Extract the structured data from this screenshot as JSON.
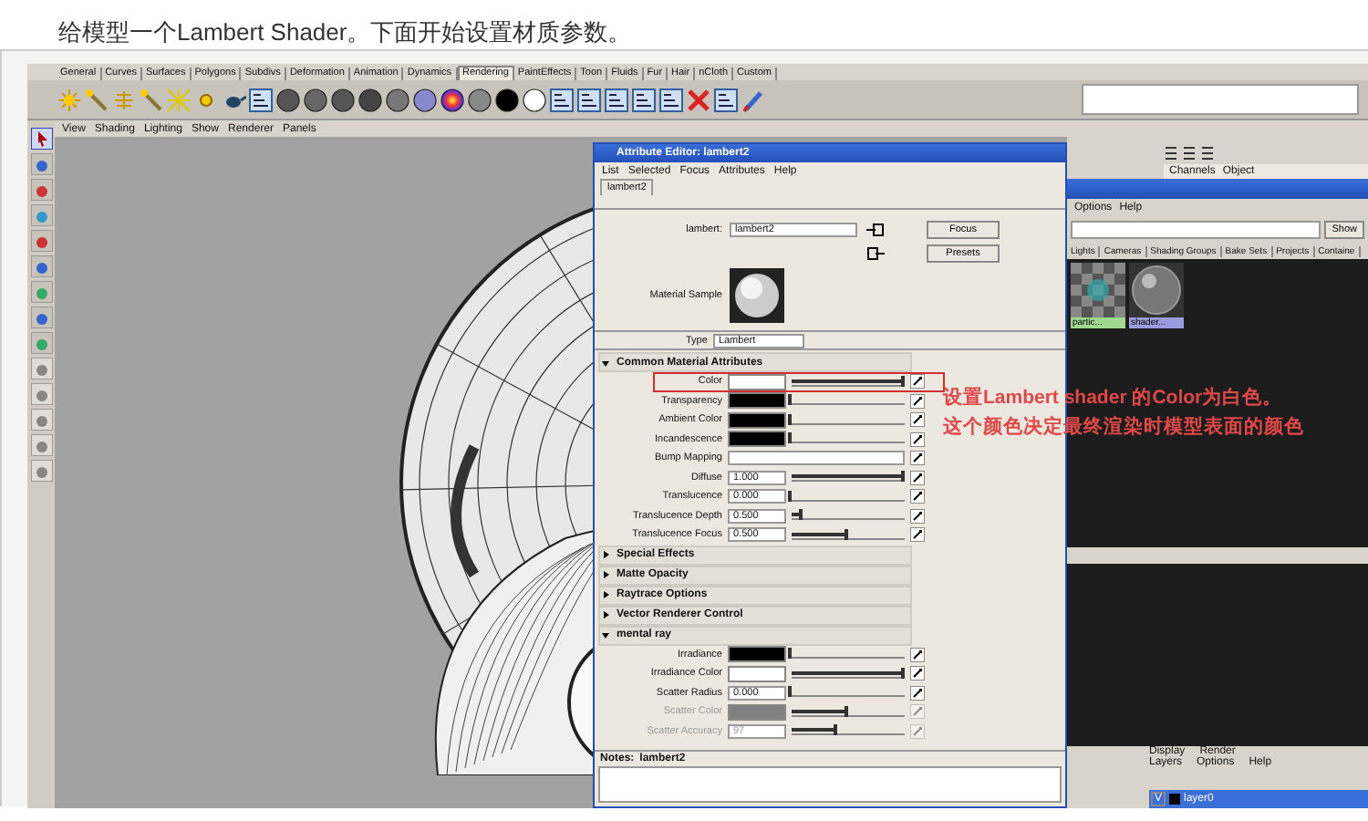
{
  "caption": "给模型一个Lambert Shader。下面开始设置材质参数。",
  "shelf_tabs": [
    {
      "label": "General",
      "selected": false
    },
    {
      "label": "Curves",
      "selected": false
    },
    {
      "label": "Surfaces",
      "selected": false
    },
    {
      "label": "Polygons",
      "selected": false
    },
    {
      "label": "Subdivs",
      "selected": false
    },
    {
      "label": "Deformation",
      "selected": false
    },
    {
      "label": "Animation",
      "selected": false
    },
    {
      "label": "Dynamics",
      "selected": false
    },
    {
      "label": "Rendering",
      "selected": true
    },
    {
      "label": "PaintEffects",
      "selected": false
    },
    {
      "label": "Toon",
      "selected": false
    },
    {
      "label": "Fluids",
      "selected": false
    },
    {
      "label": "Fur",
      "selected": false
    },
    {
      "label": "Hair",
      "selected": false
    },
    {
      "label": "nCloth",
      "selected": false
    },
    {
      "label": "Custom",
      "selected": false
    }
  ],
  "viewport_menu": [
    "View",
    "Shading",
    "Lighting",
    "Show",
    "Renderer",
    "Panels"
  ],
  "attribute_editor": {
    "title": "Attribute Editor: lambert2",
    "menu": [
      "List",
      "Selected",
      "Focus",
      "Attributes",
      "Help"
    ],
    "tab": "lambert2",
    "node_label": "lambert:",
    "node_name": "lambert2",
    "buttons": [
      "Focus",
      "Presets"
    ],
    "sample_label": "Material Sample",
    "type_label": "Type",
    "type_value": "Lambert",
    "sections": [
      {
        "title": "Common Material Attributes",
        "expanded": true,
        "attributes": [
          {
            "kind": "color",
            "label": "Color",
            "color": "#ffffff",
            "level": 1,
            "highlighted": true,
            "disabled": false
          },
          {
            "kind": "color",
            "label": "Transparency",
            "color": "#000000",
            "level": 0,
            "highlighted": false,
            "disabled": false
          },
          {
            "kind": "color",
            "label": "Ambient Color",
            "color": "#000000",
            "level": 0,
            "highlighted": false,
            "disabled": false
          },
          {
            "kind": "color",
            "label": "Incandescence",
            "color": "#000000",
            "level": 0,
            "highlighted": false,
            "disabled": false
          },
          {
            "kind": "map",
            "label": "Bump Mapping",
            "highlighted": false,
            "disabled": false
          },
          {
            "kind": "number",
            "label": "Diffuse",
            "value": "1.000",
            "level": 1,
            "highlighted": false,
            "disabled": false
          },
          {
            "kind": "number",
            "label": "Translucence",
            "value": "0.000",
            "level": 0,
            "highlighted": false,
            "disabled": false
          },
          {
            "kind": "number",
            "label": "Translucence Depth",
            "value": "0.500",
            "level": 0.1,
            "highlighted": false,
            "disabled": false
          },
          {
            "kind": "number",
            "label": "Translucence Focus",
            "value": "0.500",
            "level": 0.5,
            "highlighted": false,
            "disabled": false
          }
        ]
      },
      {
        "title": "Special Effects",
        "expanded": false
      },
      {
        "title": "Matte Opacity",
        "expanded": false
      },
      {
        "title": "Raytrace Options",
        "expanded": false
      },
      {
        "title": "Vector Renderer Control",
        "expanded": false
      },
      {
        "title": "mental ray",
        "expanded": true,
        "attributes": [
          {
            "kind": "color",
            "label": "Irradiance",
            "color": "#000000",
            "level": 0,
            "highlighted": false,
            "disabled": false
          },
          {
            "kind": "color",
            "label": "Irradiance Color",
            "color": "#ffffff",
            "level": 1,
            "highlighted": false,
            "disabled": false
          },
          {
            "kind": "number",
            "label": "Scatter Radius",
            "value": "0.000",
            "level": 0,
            "highlighted": false,
            "disabled": false
          },
          {
            "kind": "color",
            "label": "Scatter Color",
            "color": "#808080",
            "level": 0.5,
            "highlighted": false,
            "disabled": true
          },
          {
            "kind": "number",
            "label": "Scatter Accuracy",
            "value": "97",
            "level": 0.4,
            "highlighted": false,
            "disabled": true
          }
        ]
      }
    ],
    "notes_label": "Notes:",
    "notes_value": "lambert2"
  },
  "annotation": [
    "设置Lambert shader 的Color为白色。",
    "这个颜色决定最终渲染时模型表面的颜色"
  ],
  "channel_box": {
    "tabs": [
      "Channels",
      "Object"
    ]
  },
  "hypershade": {
    "menu": [
      "Options",
      "Help"
    ],
    "button": "Show",
    "tabs": [
      "Lights",
      "Cameras",
      "Shading Groups",
      "Bake Sets",
      "Projects",
      "Containe"
    ],
    "swatches": [
      {
        "label": "partic...",
        "kind": "checker"
      },
      {
        "label": "shader...",
        "kind": "sphere"
      }
    ]
  },
  "layer_editor": {
    "tabs": [
      "Display",
      "Render"
    ],
    "menu": [
      "Layers",
      "Options",
      "Help"
    ],
    "layers": [
      {
        "flag": "V",
        "name": "layer0",
        "selected": true
      }
    ]
  }
}
